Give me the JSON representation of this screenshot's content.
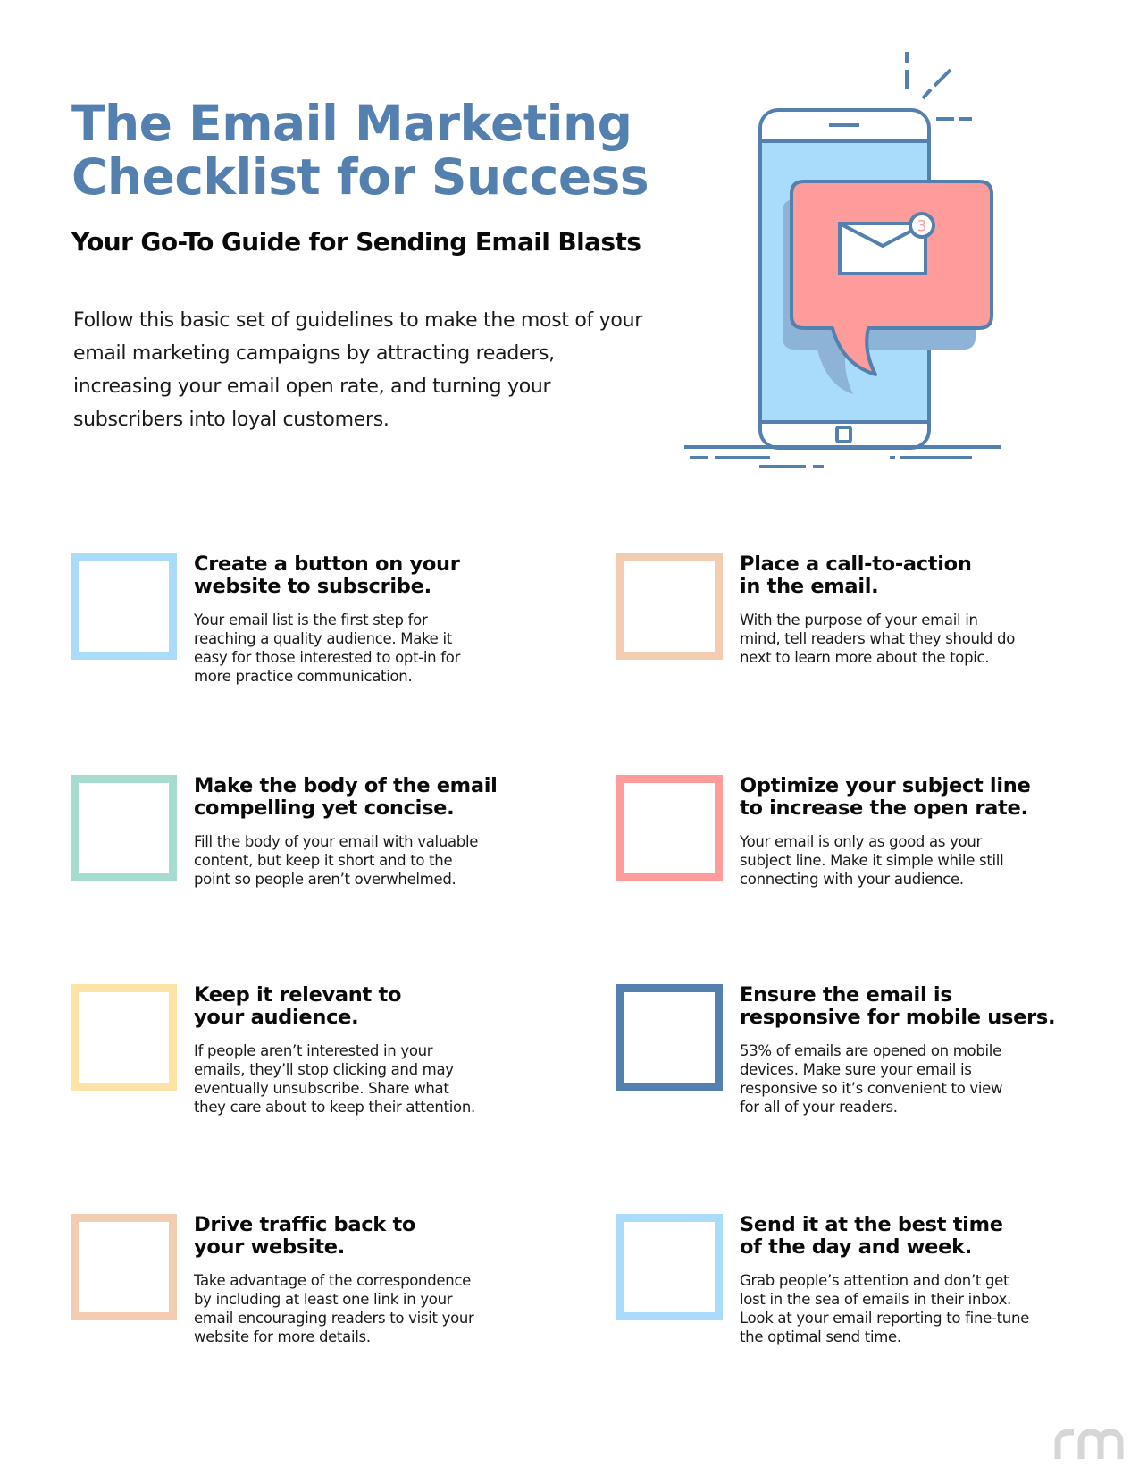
{
  "header": {
    "title_line1": "The Email Marketing",
    "title_line2": "Checklist for Success",
    "subtitle": "Your Go-To Guide for Sending Email Blasts",
    "intro": "Follow this basic set of guidelines to make the most of your email marketing campaigns by attracting readers, increasing your email open rate, and turning your subscribers into loyal customers."
  },
  "hero": {
    "icon": "phone-with-email-notification-illustration",
    "notification_count": "3",
    "colors": {
      "outline": "#5480b0",
      "screen": "#a9dcfa",
      "bubble": "#fd9c9b",
      "bubble_shadow": "#8db3d6"
    }
  },
  "checklist": [
    {
      "title": "Create a button on your\nwebsite to subscribe.",
      "description": "Your email list is the first step for\nreaching a quality audience. Make it\neasy for those interested to opt-in for\nmore practice communication.",
      "color": "#a9dcfa",
      "checked": false
    },
    {
      "title": "Place a call-to-action\nin the email.",
      "description": "With the purpose of your email in\nmind, tell readers what they should do\nnext to learn more about the topic.",
      "color": "#f4cdb0",
      "checked": false
    },
    {
      "title": "Make the body of the email\ncompelling yet concise.",
      "description": "Fill the body of your email with valuable\ncontent, but keep it short and to the\npoint so people aren’t overwhelmed.",
      "color": "#a6dbd0",
      "checked": false
    },
    {
      "title": "Optimize your subject line\nto increase the open rate.",
      "description": "Your email is only as good as your\nsubject line. Make it simple while still\nconnecting with your audience.",
      "color": "#fd9c9b",
      "checked": false
    },
    {
      "title": "Keep it relevant to\nyour audience.",
      "description": "If people aren’t interested in your\nemails, they’ll stop clicking and may\neventually unsubscribe. Share what\nthey care about to keep their attention.",
      "color": "#fde4a6",
      "checked": false
    },
    {
      "title": "Ensure the email is\nresponsive for mobile users.",
      "description": "53% of emails are opened on mobile\ndevices. Make sure your email is\nresponsive so it’s convenient to view\nfor all of your readers.",
      "color": "#5480b0",
      "checked": false
    },
    {
      "title": "Drive traffic back to\nyour website.",
      "description": "Take advantage of the correspondence\nby including at least one link in your\nemail encouraging readers to visit your\nwebsite for more details.",
      "color": "#f4cdb0",
      "checked": false
    },
    {
      "title": "Send it at the best time\nof the day and week.",
      "description": "Grab people’s attention and don’t get\nlost in the sea of emails in their inbox.\nLook at your email reporting to fine-tune\nthe optimal send time.",
      "color": "#a9dcfa",
      "checked": false
    }
  ],
  "footer": {
    "logo_text": "rm",
    "logo_color": "#d6d6d6"
  }
}
